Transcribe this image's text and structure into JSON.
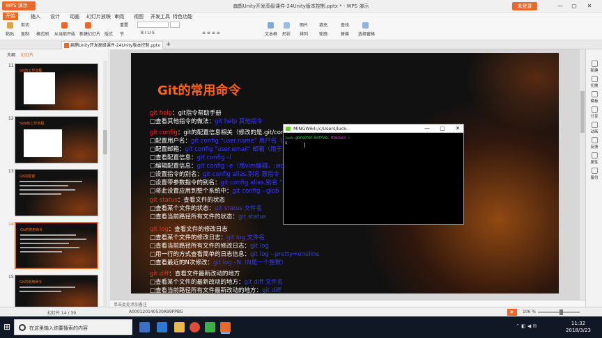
{
  "window": {
    "app_button": "WPS 演示",
    "title": "扁鹊Unity开发高级课件-24Unity版本控制.pptx * - WPS 演示",
    "login_button": "未登录",
    "minimize": "—",
    "maximize": "▢",
    "close": "✕"
  },
  "menu": [
    "开始",
    "插入",
    "设计",
    "动画",
    "幻灯片放映",
    "审阅",
    "视图",
    "开发工具",
    "特色功能"
  ],
  "ribbon": {
    "paste": "粘贴",
    "cut": "剪切",
    "copy": "复制",
    "format_painter": "格式刷",
    "from_current": "从当前开始",
    "new_slide": "新建幻灯片",
    "layout": "版式",
    "section": "节",
    "reset": "重置",
    "textbox": "文本框",
    "shape": "形状",
    "arrange": "排列",
    "picture": "图片",
    "fill": "填充",
    "outline": "轮廓",
    "find": "查找",
    "replace": "替换",
    "select_pane": "选择窗格"
  },
  "document_tab": "扁鹊Unity开发高级课件-24Unity版本控制.pptx",
  "left_panel": {
    "tabs": [
      "大纲",
      "幻灯片"
    ],
    "thumbnails": [
      {
        "number": "11",
        "title": "Git的工作流程",
        "selected": false
      },
      {
        "number": "12",
        "title": "SVN的工作流程",
        "selected": false
      },
      {
        "number": "13",
        "title": "Git的配置",
        "selected": false
      },
      {
        "number": "14",
        "title": "Git的常用命令",
        "selected": true
      },
      {
        "number": "15",
        "title": "Git的常用命令",
        "selected": false
      }
    ]
  },
  "slide": {
    "title": "Git的常用命令",
    "lines": [
      {
        "cmd": "git help",
        "text": "：git指令帮助手册",
        "blue": ""
      },
      {
        "cmd": "",
        "text": "□查看其他指令的做法：",
        "blue": "git help 其他指令"
      },
      {
        "cmd": "git config",
        "text": "：git的配置信息相关（修改的是.git/con",
        "blue": ""
      },
      {
        "cmd": "",
        "text": "□配置用户名：",
        "blue": "git config \"user.name\" 用户名（用"
      },
      {
        "cmd": "",
        "text": "□配置邮箱：",
        "blue": "git config \"user.email\" 邮箱（用于"
      },
      {
        "cmd": "",
        "text": "□查看配置信息：",
        "blue": "git config –l"
      },
      {
        "cmd": "",
        "text": "□编辑配置信息：",
        "blue": "git config –e（用vim编辑，:wq"
      },
      {
        "cmd": "",
        "text": "□设置指令的别名：",
        "blue": "git config alias.别名 原指令"
      },
      {
        "cmd": "",
        "text": "□设置带参数指令的别名：",
        "blue": "git config alias.别名 \""
      },
      {
        "cmd": "",
        "text": "□将此设置应用到整个系统中：",
        "blue": "git config --glob"
      },
      {
        "cmd": "git status",
        "text": "：查看文件的状态",
        "blue": ""
      },
      {
        "cmd": "",
        "text": "□查看某个文件的状态：",
        "blue": "git status 文件名"
      },
      {
        "cmd": "",
        "text": "□查看当前路径所有文件的状态：",
        "blue": "git status"
      },
      {
        "cmd": "git log",
        "text": "：查看文件的修改日志",
        "blue": ""
      },
      {
        "cmd": "",
        "text": "□查看某个文件的修改日志：",
        "blue": "git log 文件名"
      },
      {
        "cmd": "",
        "text": "□查看当前路径所有文件的修改日志：",
        "blue": "git log"
      },
      {
        "cmd": "",
        "text": "□用一行的方式查看简单的日志信息：",
        "blue": "git log --pretty=oneline"
      },
      {
        "cmd": "",
        "text": "□查看最近的N次修改：",
        "blue": "git log –N（N是一个整数）"
      },
      {
        "cmd": "git diff",
        "text": "：查看文件最新改动的地方",
        "blue": ""
      },
      {
        "cmd": "",
        "text": "□查看某个文件的最新改动的地方：",
        "blue": "git diff 文件名"
      },
      {
        "cmd": "",
        "text": "□查看当前路径所有文件最新改动的地方：",
        "blue": "git diff"
      }
    ]
  },
  "terminal": {
    "title": "MINGW64:/c/Users/luck-",
    "prompt_user": "luck-@DESKTOP-M4TFVKL",
    "prompt_env": "MINGW64",
    "prompt_path": "~",
    "prompt_symbol": "$"
  },
  "right_panel": [
    "新建",
    "切换",
    "模板",
    "分享",
    "动画",
    "反馈",
    "属性",
    "备份"
  ],
  "notes_placeholder": "单击此处添加备注",
  "status": {
    "slide_counter": "幻灯片 14 / 39",
    "theme": "A000120140530A99PPBG",
    "zoom": "106 %"
  },
  "taskbar": {
    "search_placeholder": "在这里输入你要搜索的内容",
    "time": "11:32",
    "date": "2018/3/23"
  }
}
